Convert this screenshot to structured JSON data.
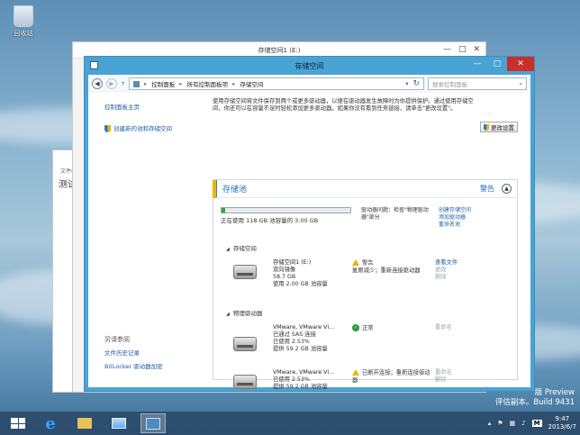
{
  "desktop": {
    "recycle_label": "回收站",
    "watermark_line1": "版 Preview",
    "watermark_line2": "评估副本。Build 9431"
  },
  "back_window": {
    "menu": "文件(F)",
    "text": "测试数"
  },
  "window": {
    "title": "存储空间",
    "back_title": "存储空间1 (E:)",
    "controls": {
      "minimize": "—",
      "maximize": "□",
      "close": "✕"
    },
    "breadcrumb": [
      "控制面板",
      "所有控制面板项",
      "存储空间"
    ],
    "search_placeholder": "搜索控制面板"
  },
  "left": {
    "home": "控制面板主页",
    "create": "创建新的池和存储空间",
    "see_also_header": "另请参阅",
    "see_also": [
      "文件历史记录",
      "BitLocker 驱动器加密"
    ]
  },
  "description": "使用存储空间将文件保存到两个或更多驱动器，以便在驱动器发生故障时为你提供保护。通过使用存储空间，你还可以在容量不足时轻松添加更多驱动器。如果你没有看到任务链接，请单击\"更改设置\"。",
  "change_settings": "更改设置",
  "pool": {
    "title": "存储池",
    "status": "警告",
    "usage_fraction": 0.026,
    "capacity_text": "正在使用 118 GB 池容量的 3.00 GB",
    "status_text": "驱动器问题：检查\"物理驱动器\"部分",
    "links": [
      "创建存储空间",
      "添加驱动器",
      "重命名池"
    ]
  },
  "sections": {
    "spaces": "存储空间",
    "physical": "物理驱动器"
  },
  "spaces": [
    {
      "name": "存储空间1 (E:)",
      "lines": [
        "双向镜像",
        "58.7 GB",
        "使用 2.00 GB 池容量"
      ],
      "status_title": "警告",
      "status_detail": "复原减少；重新连接驱动器",
      "links": [
        "查看文件",
        "更改",
        "删除"
      ]
    }
  ],
  "drives": [
    {
      "name": "VMware, VMware Vi...",
      "lines": [
        "已通过 SAS 连接",
        "已使用 2.53%",
        "提供 59.2 GB 池容量"
      ],
      "status_title": "正常",
      "status_detail": "",
      "links": [
        "重命名"
      ]
    },
    {
      "name": "VMware, VMware Vi...",
      "lines": [
        "已使用 2.53%",
        "提供 59.2 GB 池容量"
      ],
      "status_title": "",
      "status_detail": "已断开连接；重新连接驱动器",
      "links": [
        "重命名",
        "删除"
      ]
    }
  ],
  "taskbar": {
    "time": "9:47",
    "date": "2013/6/7",
    "ime": "M"
  },
  "colors": {
    "accent": "#49a3d4",
    "warning": "#e8b800",
    "ok": "#2a9a3a",
    "link": "#1e5b9c"
  }
}
